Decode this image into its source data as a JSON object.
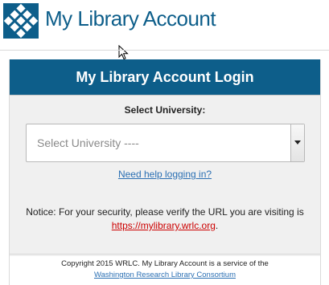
{
  "header": {
    "logo_icon": "diamond-grid-logo-icon",
    "title": "My Library Account",
    "brand_color": "#0d5e8a"
  },
  "login": {
    "title": "My Library Account Login",
    "select_label": "Select University:",
    "select_value": "Select University ----",
    "select_arrow_icon": "chevron-down-icon",
    "help_link": "Need help logging in?",
    "notice_text": "Notice: For your security, please verify the URL you are visiting is",
    "notice_url": "https://mylibrary.wrlc.org",
    "notice_end": "."
  },
  "footer": {
    "copyright": "Copyright 2015 WRLC. My Library Account is a service of the",
    "consortium_link": "Washington Research Library Consortium"
  }
}
